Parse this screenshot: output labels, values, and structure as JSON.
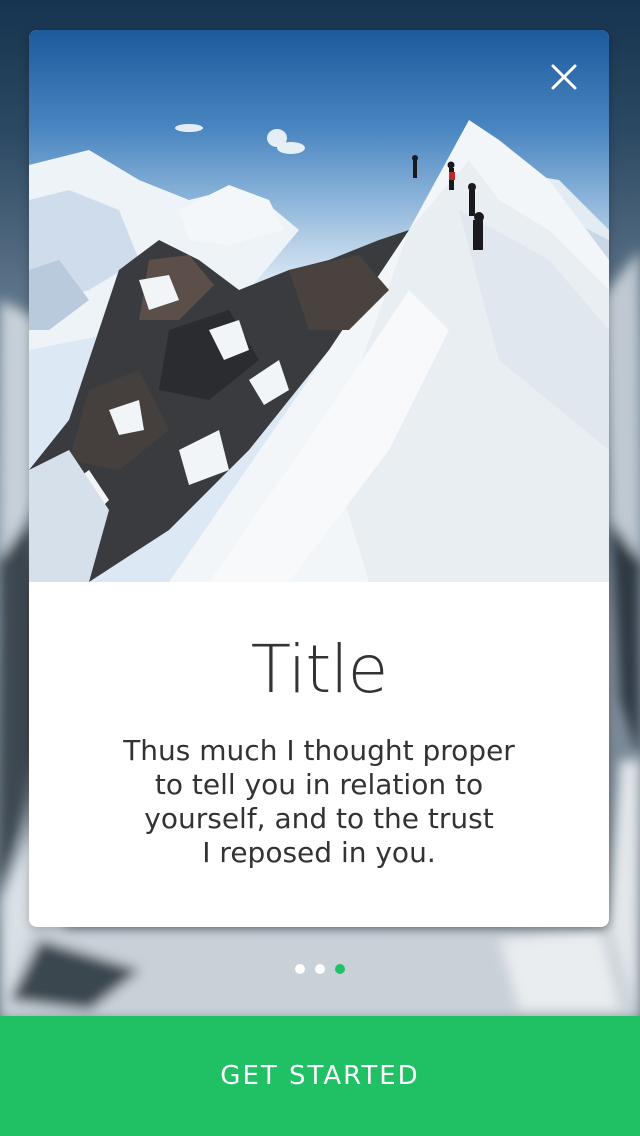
{
  "onboarding": {
    "title": "Title",
    "body": "Thus much I thought proper\nto tell you in relation to\nyourself, and to the trust\nI reposed in you.",
    "close_icon": "close-icon",
    "image_subject": "mountain-climbers-on-snowy-ridge"
  },
  "pagination": {
    "total": 3,
    "active_index": 2,
    "active_color": "#20c064",
    "inactive_color": "#ffffff"
  },
  "cta": {
    "label": "GET STARTED",
    "color": "#20c064"
  }
}
